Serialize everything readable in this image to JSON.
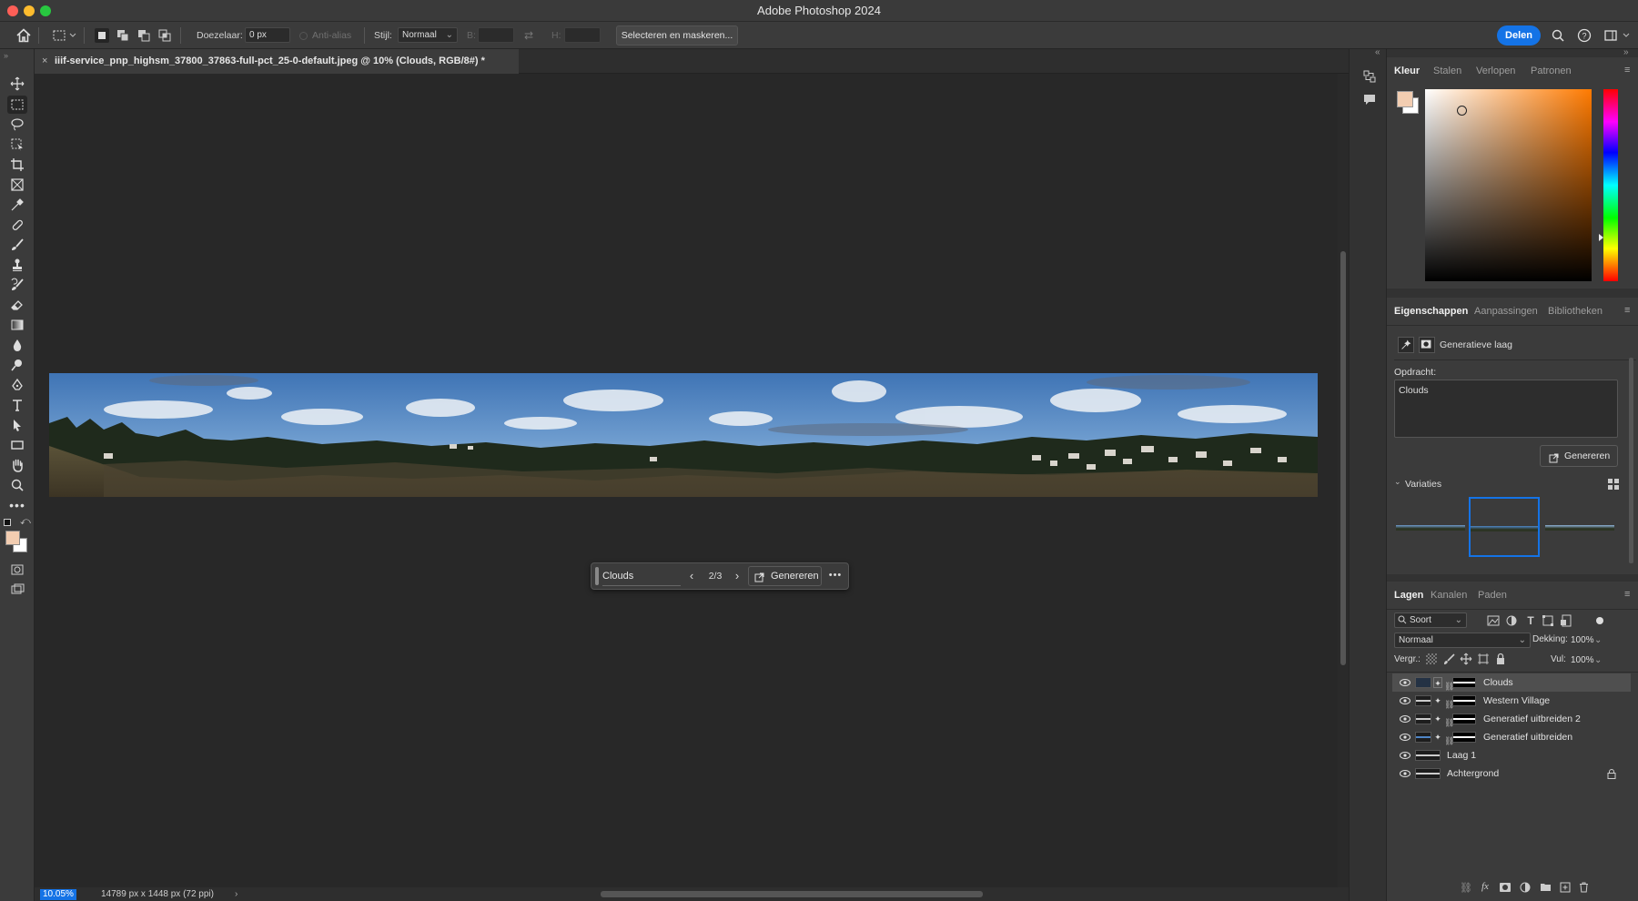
{
  "app": {
    "title": "Adobe Photoshop 2024"
  },
  "options": {
    "feather_label": "Doezelaar:",
    "feather_value": "0 px",
    "antialias_label": "Anti-alias",
    "style_label": "Stijl:",
    "style_value": "Normaal",
    "width_label": "B:",
    "height_label": "H:",
    "select_mask_label": "Selecteren en maskeren...",
    "share_label": "Delen"
  },
  "document": {
    "tab_title": "iiif-service_pnp_highsm_37800_37863-full-pct_25-0-default.jpeg @ 10% (Clouds, RGB/8#) *",
    "zoom": "10.05%",
    "dimensions": "14789 px x 1448 px (72 ppi)"
  },
  "gen_toolbar": {
    "prompt": "Clouds",
    "counter": "2/3",
    "generate_label": "Genereren"
  },
  "color_panel": {
    "tabs": [
      "Kleur",
      "Stalen",
      "Verlopen",
      "Patronen"
    ],
    "foreground": "#f2cdb1",
    "background": "#ffffff"
  },
  "properties_panel": {
    "tabs": [
      "Eigenschappen",
      "Aanpassingen",
      "Bibliotheken"
    ],
    "layer_type": "Generatieve laag",
    "prompt_label": "Opdracht:",
    "prompt_value": "Clouds",
    "generate_label": "Genereren",
    "variations_label": "Variaties"
  },
  "layers_panel": {
    "tabs": [
      "Lagen",
      "Kanalen",
      "Paden"
    ],
    "filter_kind": "Soort",
    "blend_mode": "Normaal",
    "opacity_label": "Dekking:",
    "opacity_value": "100%",
    "lock_label": "Vergr.:",
    "fill_label": "Vul:",
    "fill_value": "100%",
    "layers": [
      {
        "name": "Clouds",
        "generative": true,
        "selected": true
      },
      {
        "name": "Western Village",
        "generative": true,
        "selected": false
      },
      {
        "name": "Generatief uitbreiden 2",
        "generative": true,
        "selected": false
      },
      {
        "name": "Generatief uitbreiden",
        "generative": true,
        "selected": false
      },
      {
        "name": "Laag 1",
        "generative": false,
        "selected": false
      },
      {
        "name": "Achtergrond",
        "generative": false,
        "selected": false,
        "locked": true
      }
    ]
  },
  "colors": {
    "accent": "#1473e6",
    "panel_bg": "#3b3b3b",
    "canvas_bg": "#282828"
  }
}
